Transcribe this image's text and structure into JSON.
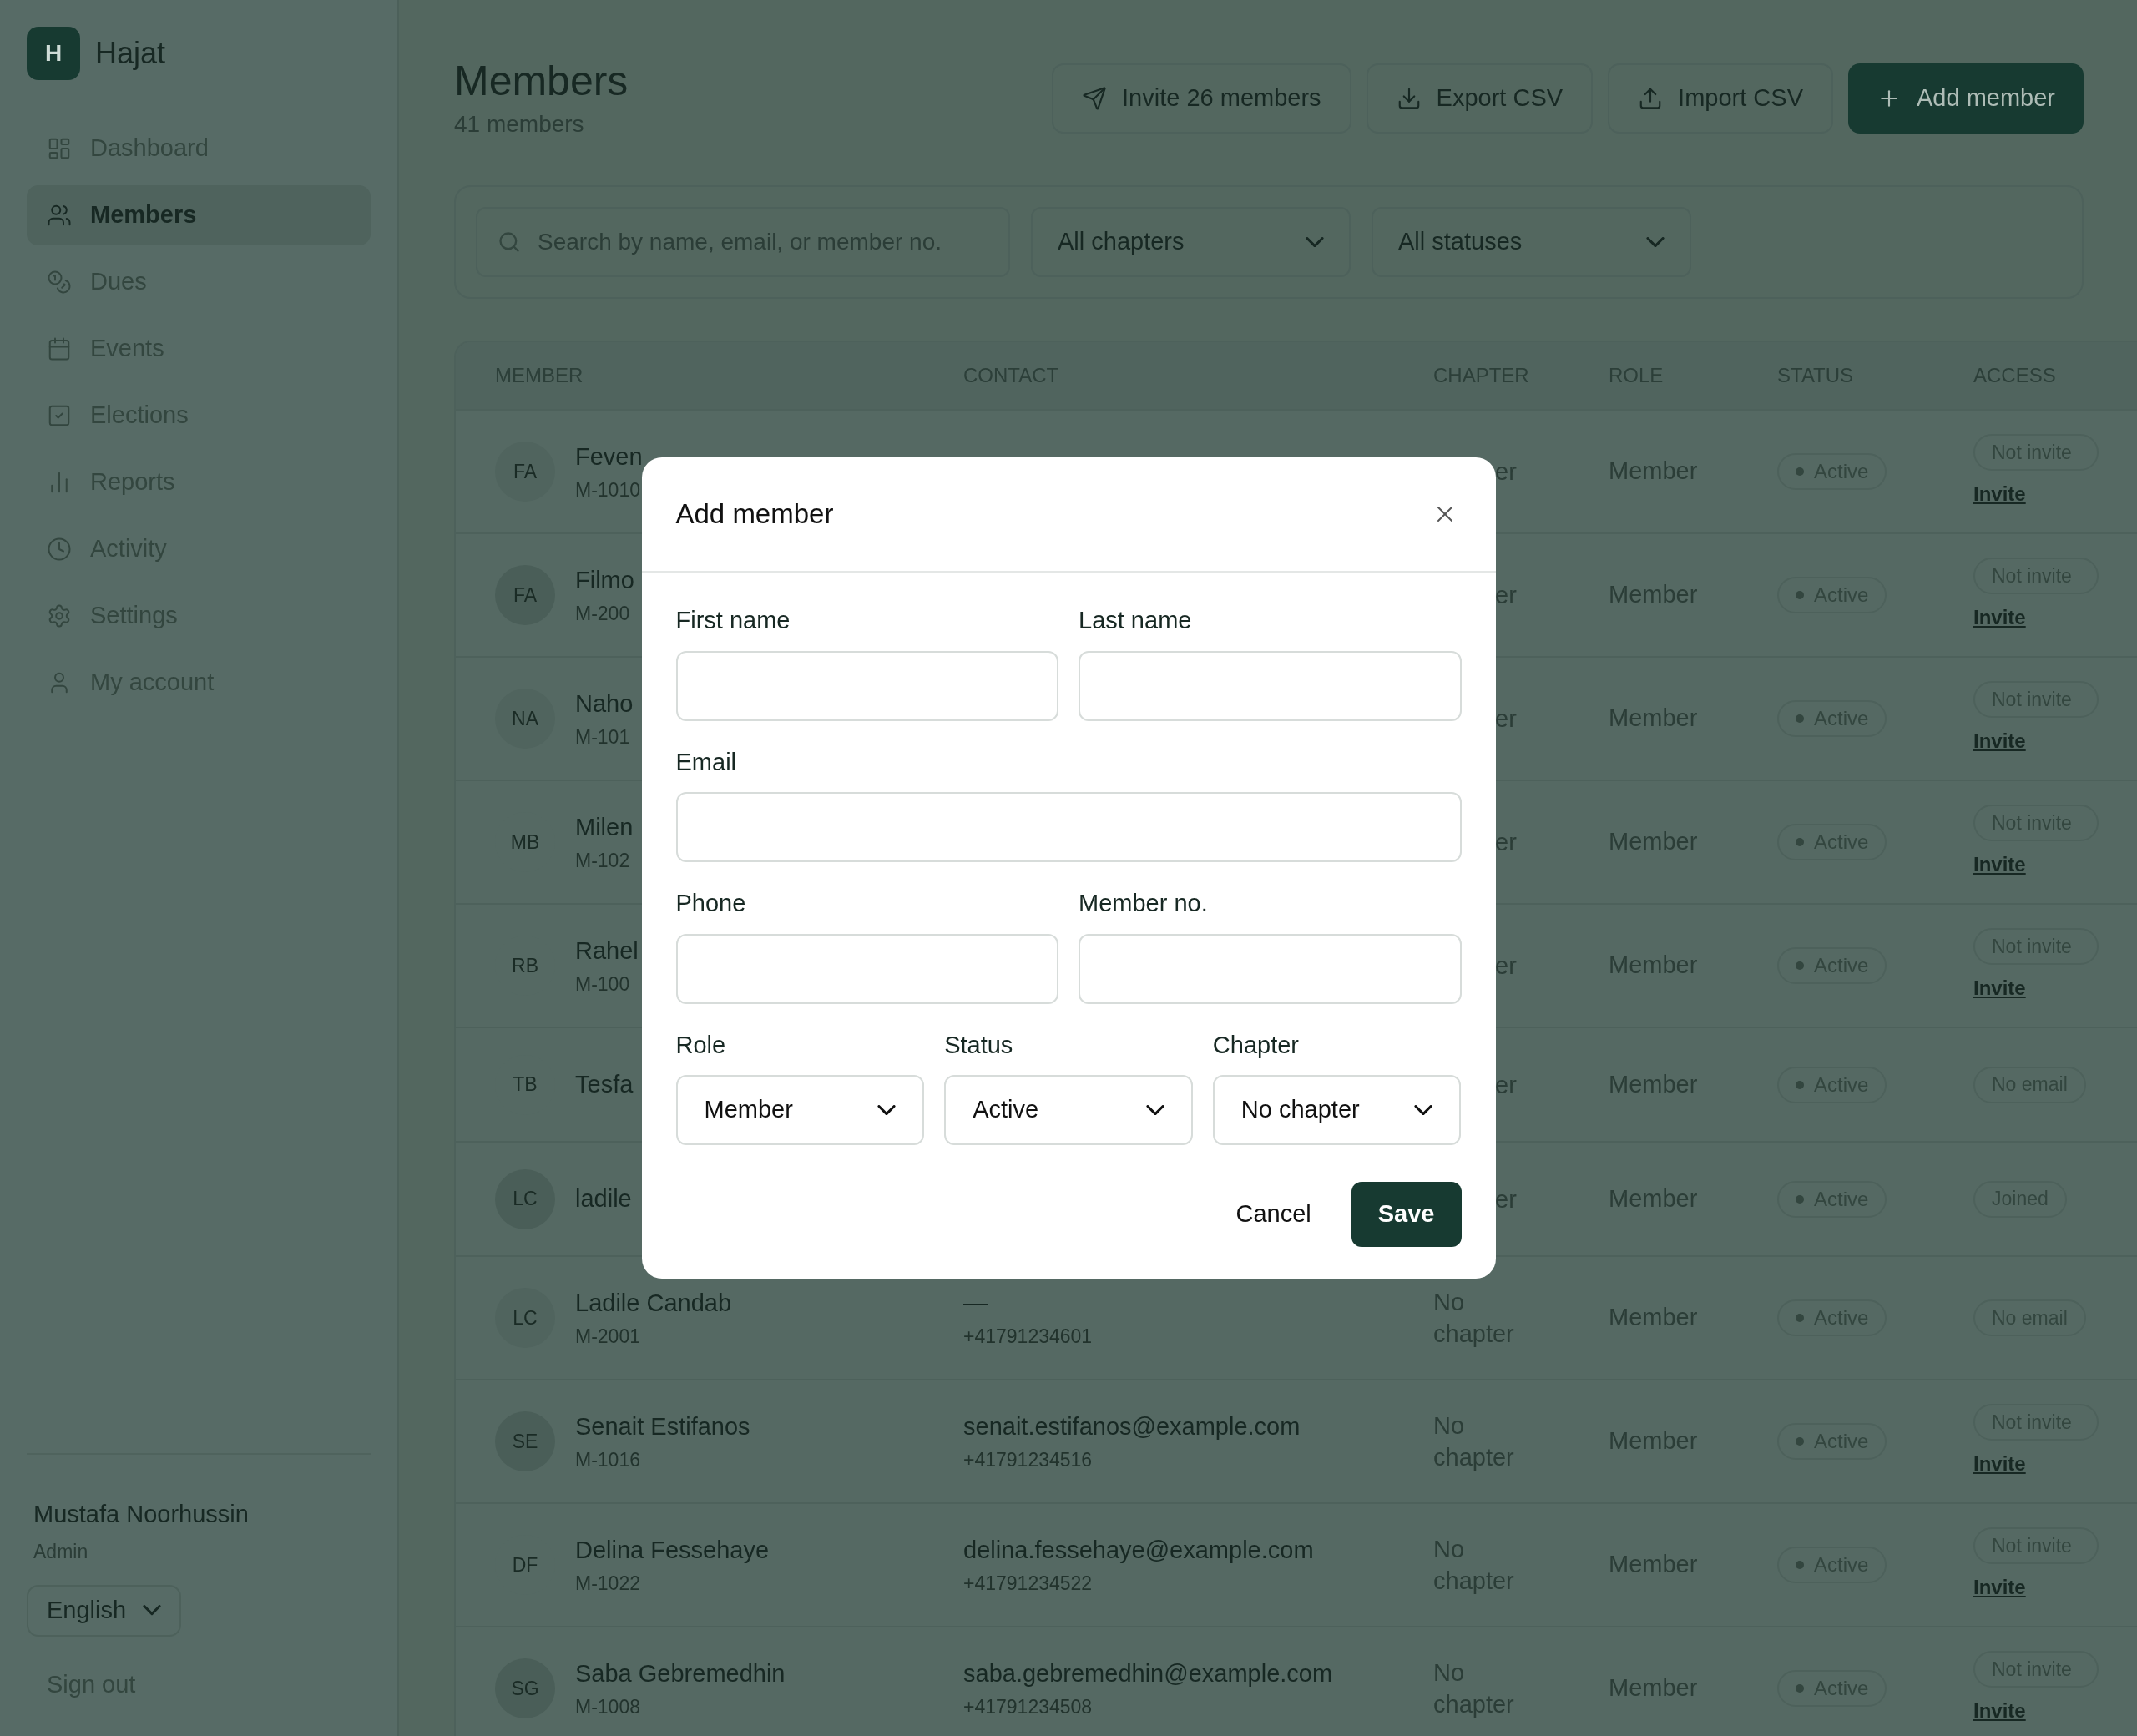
{
  "brand": {
    "logo_letter": "H",
    "name": "Hajat"
  },
  "sidebar": {
    "items": [
      {
        "label": "Dashboard",
        "selected": false
      },
      {
        "label": "Members",
        "selected": true
      },
      {
        "label": "Dues",
        "selected": false
      },
      {
        "label": "Events",
        "selected": false
      },
      {
        "label": "Elections",
        "selected": false
      },
      {
        "label": "Reports",
        "selected": false
      },
      {
        "label": "Activity",
        "selected": false
      },
      {
        "label": "Settings",
        "selected": false
      },
      {
        "label": "My account",
        "selected": false
      }
    ],
    "user": {
      "name": "Mustafa Noorhussin",
      "role": "Admin"
    },
    "language": "English",
    "sign_out": "Sign out"
  },
  "header": {
    "title": "Members",
    "subtitle": "41 members",
    "buttons": [
      {
        "label": "Invite 26 members",
        "kind": "invite"
      },
      {
        "label": "Export CSV",
        "kind": "export"
      },
      {
        "label": "Import CSV",
        "kind": "import"
      },
      {
        "label": "Add member",
        "kind": "primary"
      }
    ]
  },
  "filters": {
    "search": {
      "placeholder": "Search by name, email, or member no."
    },
    "chapter": "All chapters",
    "status": "All statuses"
  },
  "table": {
    "columns": [
      "MEMBER",
      "CONTACT",
      "CHAPTER",
      "ROLE",
      "STATUS",
      "ACCESS"
    ],
    "rows": [
      {
        "initials": "FA",
        "color": "#50645e",
        "name": "Feven",
        "number": "M-1010",
        "chapter": "er",
        "covered": true,
        "role": "Member",
        "status": "Active",
        "access": {
          "kind": "not_invited",
          "badge": "Not invite",
          "link": "Invite"
        }
      },
      {
        "initials": "FA",
        "color": "#4a5e58",
        "name": "Filmo",
        "number": "M-200",
        "chapter": "er",
        "covered": true,
        "role": "Member",
        "status": "Active",
        "access": {
          "kind": "not_invited",
          "badge": "Not invite",
          "link": "Invite"
        }
      },
      {
        "initials": "NA",
        "color": "#50645e",
        "name": "Naho",
        "number": "M-101",
        "chapter": "er",
        "covered": true,
        "role": "Member",
        "status": "Active",
        "access": {
          "kind": "not_invited",
          "badge": "Not invite",
          "link": "Invite"
        }
      },
      {
        "initials": "MB",
        "color": "#556963",
        "name": "Milen",
        "number": "M-102",
        "chapter": "er",
        "covered": true,
        "role": "Member",
        "status": "Active",
        "access": {
          "kind": "not_invited",
          "badge": "Not invite",
          "link": "Invite"
        }
      },
      {
        "initials": "RB",
        "color": "#556963",
        "name": "Rahel",
        "number": "M-100",
        "chapter": "er",
        "covered": true,
        "role": "Member",
        "status": "Active",
        "access": {
          "kind": "not_invited",
          "badge": "Not invite",
          "link": "Invite"
        }
      },
      {
        "initials": "TB",
        "color": "#556963",
        "name": "Tesfa",
        "chapter": "er",
        "covered": true,
        "role": "Member",
        "status": "Active",
        "access": {
          "kind": "no_email",
          "badge": "No email"
        }
      },
      {
        "initials": "LC",
        "color": "#4a5e58",
        "name": "ladile",
        "chapter": "er",
        "covered": true,
        "role": "Member",
        "status": "Active",
        "access": {
          "kind": "joined",
          "badge": "Joined"
        }
      },
      {
        "initials": "LC",
        "color": "#50645e",
        "name": "Ladile Candab",
        "number": "M-2001",
        "email": "—",
        "phone": "+41791234601",
        "chapter": "No chapter",
        "covered": false,
        "role": "Member",
        "status": "Active",
        "access": {
          "kind": "no_email",
          "badge": "No email"
        }
      },
      {
        "initials": "SE",
        "color": "#4a5e58",
        "name": "Senait Estifanos",
        "number": "M-1016",
        "email": "senait.estifanos@example.com",
        "phone": "+41791234516",
        "chapter": "No chapter",
        "covered": false,
        "role": "Member",
        "status": "Active",
        "access": {
          "kind": "not_invited",
          "badge": "Not invite",
          "link": "Invite"
        }
      },
      {
        "initials": "DF",
        "color": "#556963",
        "name": "Delina Fessehaye",
        "number": "M-1022",
        "email": "delina.fessehaye@example.com",
        "phone": "+41791234522",
        "chapter": "No chapter",
        "covered": false,
        "role": "Member",
        "status": "Active",
        "access": {
          "kind": "not_invited",
          "badge": "Not invite",
          "link": "Invite"
        }
      },
      {
        "initials": "SG",
        "color": "#4a5e58",
        "name": "Saba Gebremedhin",
        "number": "M-1008",
        "email": "saba.gebremedhin@example.com",
        "phone": "+41791234508",
        "chapter": "No chapter",
        "covered": false,
        "role": "Member",
        "status": "Active",
        "access": {
          "kind": "not_invited",
          "badge": "Not invite",
          "link": "Invite"
        }
      }
    ]
  },
  "dialog": {
    "title": "Add member",
    "fields": [
      {
        "label": "First name",
        "kind": "text"
      },
      {
        "label": "Last name",
        "kind": "text"
      },
      {
        "label": "Email",
        "kind": "text",
        "wide": true
      },
      {
        "label": "Phone",
        "kind": "text"
      },
      {
        "label": "Member no.",
        "kind": "text"
      }
    ],
    "selects": [
      {
        "label": "Role",
        "value": "Member"
      },
      {
        "label": "Status",
        "value": "Active"
      },
      {
        "label": "Chapter",
        "value": "No chapter"
      }
    ],
    "cancel": "Cancel",
    "save": "Save"
  }
}
